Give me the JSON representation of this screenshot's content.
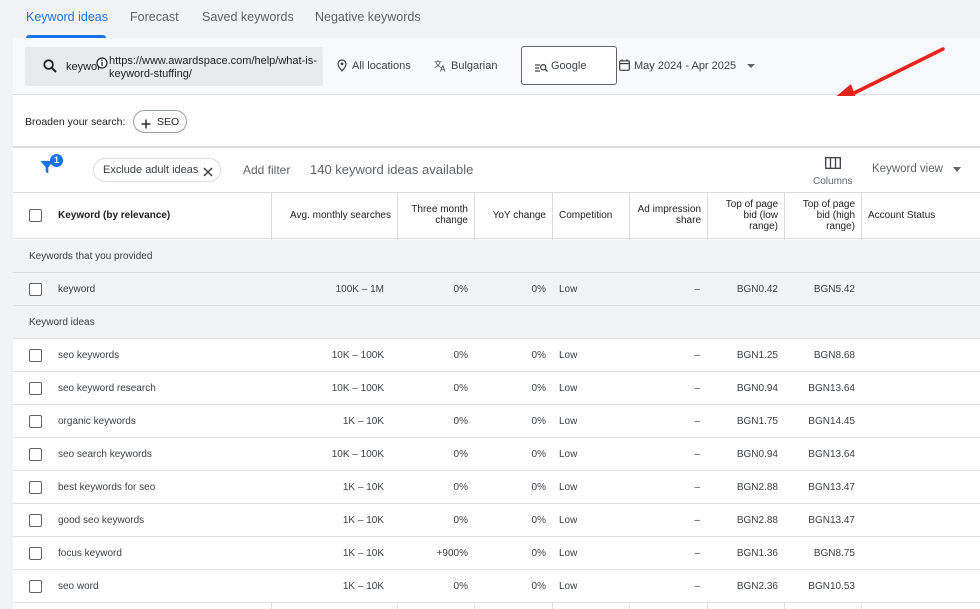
{
  "tabs": [
    {
      "label": "Keyword ideas",
      "active": true
    },
    {
      "label": "Forecast"
    },
    {
      "label": "Saved keywords"
    },
    {
      "label": "Negative keywords"
    }
  ],
  "search": {
    "keyword": "keyword",
    "url": "https://www.awardspace.com/help/what-is-keyword-stuffing/"
  },
  "settings": {
    "location": "All locations",
    "language": "Bulgarian",
    "network": "Google",
    "date_range": "May 2024 - Apr 2025"
  },
  "broaden": {
    "label": "Broaden your search:",
    "chip": "SEO"
  },
  "filters": {
    "badge": "1",
    "chip": "Exclude adult ideas",
    "add_filter": "Add filter",
    "count_text": "140 keyword ideas available",
    "columns_label": "Columns",
    "view_label": "Keyword view"
  },
  "table": {
    "headers": {
      "keyword": "Keyword (by relevance)",
      "avg": "Avg. monthly searches",
      "three_month": [
        "Three month",
        "change"
      ],
      "yoy": "YoY change",
      "competition": "Competition",
      "ad_impression": [
        "Ad impression",
        "share"
      ],
      "low_bid": [
        "Top of page",
        "bid (low",
        "range)"
      ],
      "high_bid": [
        "Top of page",
        "bid (high",
        "range)"
      ],
      "account_status": "Account Status"
    },
    "section_provided": "Keywords that you provided",
    "section_ideas": "Keyword ideas",
    "provided_rows": [
      {
        "keyword": "keyword",
        "avg": "100K – 1M",
        "three": "0%",
        "yoy": "0%",
        "comp": "Low",
        "impr": "–",
        "low": "BGN0.42",
        "high": "BGN5.42"
      }
    ],
    "idea_rows": [
      {
        "keyword": "seo keywords",
        "avg": "10K – 100K",
        "three": "0%",
        "yoy": "0%",
        "comp": "Low",
        "impr": "–",
        "low": "BGN1.25",
        "high": "BGN8.68"
      },
      {
        "keyword": "seo keyword research",
        "avg": "10K – 100K",
        "three": "0%",
        "yoy": "0%",
        "comp": "Low",
        "impr": "–",
        "low": "BGN0.94",
        "high": "BGN13.64"
      },
      {
        "keyword": "organic keywords",
        "avg": "1K – 10K",
        "three": "0%",
        "yoy": "0%",
        "comp": "Low",
        "impr": "–",
        "low": "BGN1.75",
        "high": "BGN14.45"
      },
      {
        "keyword": "seo search keywords",
        "avg": "10K – 100K",
        "three": "0%",
        "yoy": "0%",
        "comp": "Low",
        "impr": "–",
        "low": "BGN0.94",
        "high": "BGN13.64"
      },
      {
        "keyword": "best keywords for seo",
        "avg": "1K – 10K",
        "three": "0%",
        "yoy": "0%",
        "comp": "Low",
        "impr": "–",
        "low": "BGN2.88",
        "high": "BGN13.47"
      },
      {
        "keyword": "good seo keywords",
        "avg": "1K – 10K",
        "three": "0%",
        "yoy": "0%",
        "comp": "Low",
        "impr": "–",
        "low": "BGN2.88",
        "high": "BGN13.47"
      },
      {
        "keyword": "focus keyword",
        "avg": "1K – 10K",
        "three": "+900%",
        "yoy": "0%",
        "comp": "Low",
        "impr": "–",
        "low": "BGN1.36",
        "high": "BGN8.75"
      },
      {
        "keyword": "seo word",
        "avg": "1K – 10K",
        "three": "0%",
        "yoy": "0%",
        "comp": "Low",
        "impr": "–",
        "low": "BGN2.36",
        "high": "BGN10.53"
      }
    ]
  },
  "colors": {
    "accent": "#1a73e8",
    "annotation_arrow": "#e8231c"
  }
}
